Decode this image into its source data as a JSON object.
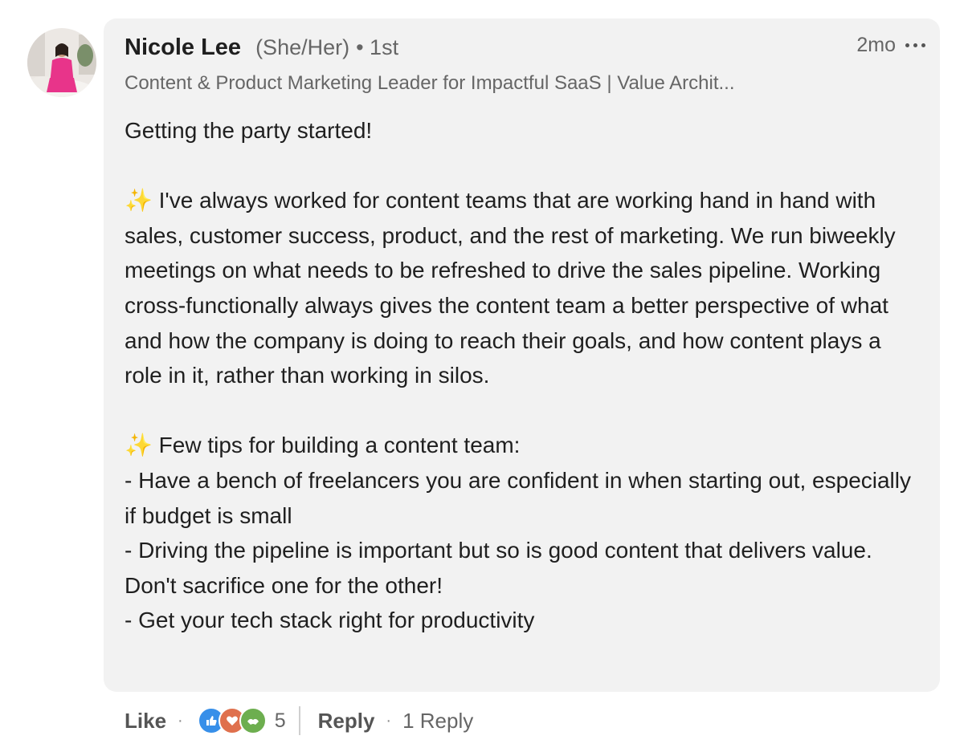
{
  "comment": {
    "author": {
      "name": "Nicole Lee",
      "pronouns": "(She/Her)",
      "degree": "• 1st",
      "headline": "Content & Product Marketing Leader for Impactful SaaS | Value Archit..."
    },
    "time_ago": "2mo",
    "body": {
      "p1": "Getting the party started!",
      "sparkle": "✨",
      "p2_text": " I've always worked for content teams that are working hand in hand with sales, customer success, product, and the rest of marketing. We run biweekly meetings on what needs to be refreshed to drive the sales pipeline. Working cross-functionally always gives the content team a better perspective of what and how the company is doing to reach their goals, and how content plays a role in it, rather than working in silos.",
      "p3_heading": " Few tips for building a content team:",
      "tips": [
        "- Have a bench of freelancers you are confident in when starting out, especially if budget is small",
        "- Driving the pipeline is important but so is good content that delivers value. Don't sacrifice one for the other!",
        "- Get your tech stack right for productivity"
      ]
    },
    "actions": {
      "like_label": "Like",
      "separator": "·",
      "reaction_icons": [
        "like-reaction-icon",
        "love-reaction-icon",
        "support-reaction-icon"
      ],
      "reaction_count": "5",
      "reply_label": "Reply",
      "reply_count": "1 Reply"
    }
  },
  "colors": {
    "bubble_bg": "#f2f2f2",
    "like_blue": "#378fe9",
    "love_red": "#df704d",
    "support_green": "#6dae4f",
    "avatar_outfit_pink": "#e8348a"
  }
}
